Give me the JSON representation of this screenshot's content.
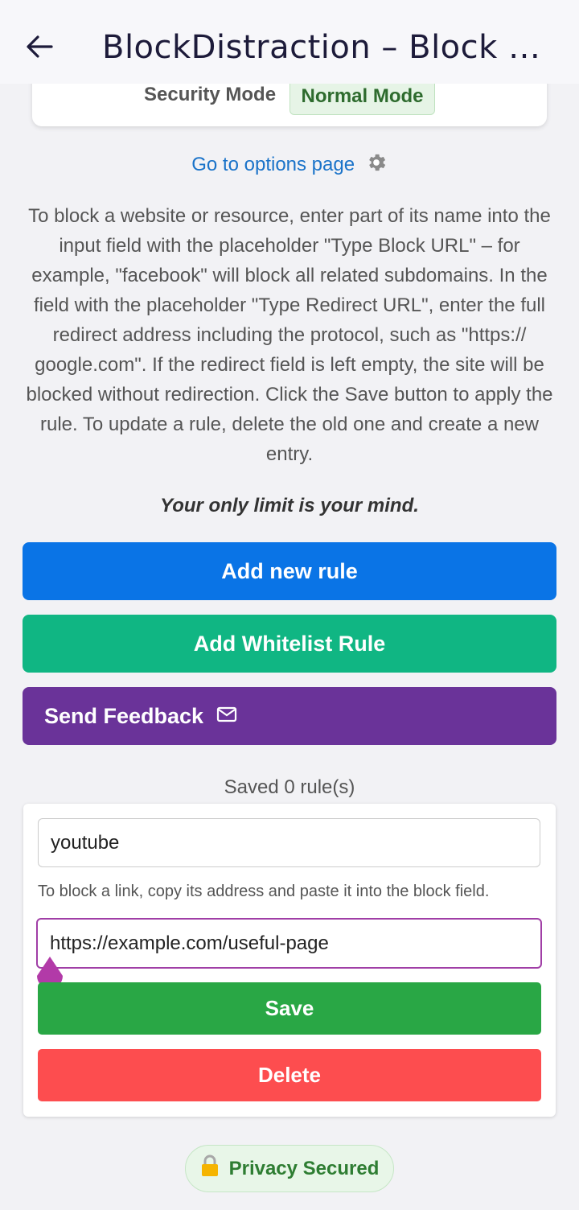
{
  "appbar": {
    "title": "BlockDistraction – Block Sit…",
    "back_icon": "arrow-left-icon"
  },
  "mode": {
    "label": "Security Mode",
    "value": "Normal Mode"
  },
  "options_link": {
    "label": "Go to options page",
    "icon": "gear-icon"
  },
  "instructions": "To block a website or resource, enter part of its name into the input field with the placeholder \"Type Block URL\" – for example, \"facebook\" will block all related subdomains. In the field with the placeholder \"Type Redirect URL\", enter the full redirect address including the protocol, such as \"https:// google.com\". If the redirect field is left empty, the site will be blocked without redirection. Click the Save button to apply the rule. To update a rule, delete the old one and create a new entry.",
  "motto": "Your only limit is your mind.",
  "buttons": {
    "add_rule": "Add new rule",
    "add_whitelist": "Add Whitelist Rule",
    "send_feedback": "Send Feedback",
    "feedback_icon": "mail-icon"
  },
  "saved_count": "Saved 0 rule(s)",
  "rule": {
    "block_value": "youtube",
    "hint": "To block a link, copy its address and paste it into the block field.",
    "redirect_value": "https://example.com/useful-page",
    "save_label": "Save",
    "delete_label": "Delete"
  },
  "privacy": {
    "label": "Privacy Secured",
    "icon": "lock-icon"
  },
  "colors": {
    "add_rule": "#0a74e6",
    "add_whitelist": "#10b683",
    "send_feedback": "#6a3399",
    "save": "#29a745",
    "delete": "#fd4d4f",
    "focus_border": "#a03ea6",
    "link": "#1a73c9"
  }
}
